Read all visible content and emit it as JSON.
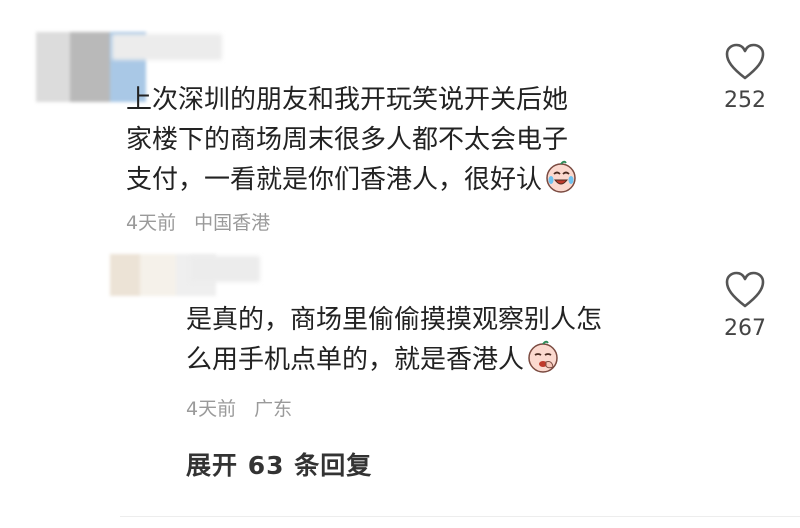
{
  "comments": [
    {
      "lines": [
        "上次深圳的朋友和我开玩笑说开关后她",
        "家楼下的商场周末很多人都不太会电子",
        "支付，一看就是你们香港人，很好认"
      ],
      "emoji": "laughing-crying-face-icon",
      "time": "4天前",
      "location": "中国香港",
      "likes": "252",
      "avatar_colors": [
        "#dcdcdc",
        "#b9b9b9",
        "#a9c8e6",
        "#d8dbe2"
      ]
    },
    {
      "lines": [
        "是真的，商场里偷偷摸摸观察别人怎",
        "么用手机点单的，就是香港人"
      ],
      "emoji": "sneaky-laugh-face-icon",
      "time": "4天前",
      "location": "广东",
      "likes": "267",
      "avatar_colors": [
        "#ece3d6",
        "#f5f1ea",
        "#efefef",
        "#d9d9d9"
      ]
    }
  ],
  "expand_replies": "展开 63 条回复",
  "colors": {
    "heart_stroke": "#555555",
    "meta": "#9a9a9a",
    "text": "#222222"
  }
}
